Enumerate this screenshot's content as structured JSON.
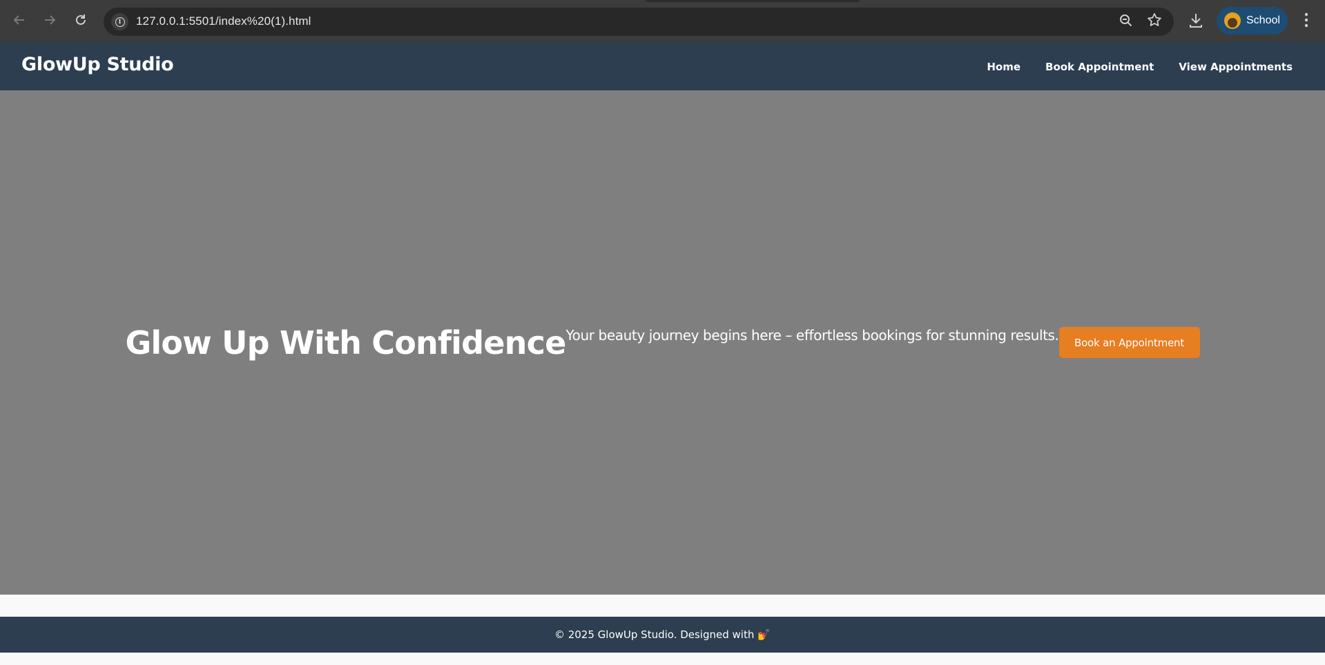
{
  "browser": {
    "url": "127.0.0.1:5501/index%20(1).html",
    "profile_label": "School"
  },
  "header": {
    "brand": "GlowUp Studio",
    "nav": [
      {
        "label": "Home"
      },
      {
        "label": "Book Appointment"
      },
      {
        "label": "View Appointments"
      }
    ]
  },
  "hero": {
    "title": "Glow Up With Confidence",
    "subtitle": "Your beauty journey begins here – effortless bookings for stunning results.",
    "cta_label": "Book an Appointment"
  },
  "footer": {
    "text": "© 2025 GlowUp Studio. Designed with",
    "emoji": "💅"
  },
  "colors": {
    "header_bg": "#2c3e50",
    "hero_bg": "#7f7f7f",
    "accent": "#e67e22"
  }
}
